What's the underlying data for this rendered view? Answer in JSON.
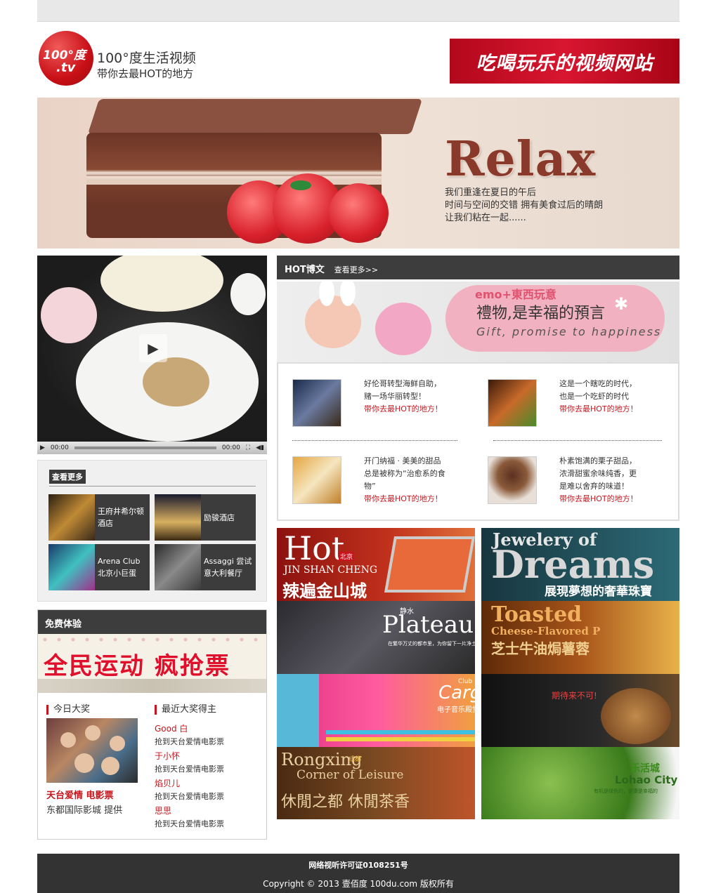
{
  "header": {
    "logo_top": "100°度",
    "logo_bottom": ".tv",
    "site_name": "100°度生活视频",
    "tagline": "带你去最HOT的地方",
    "slogan": "吃喝玩乐的视频网站"
  },
  "banner": {
    "headline": "Relax",
    "lines": [
      "我们重逢在夏日的午后",
      "时间与空间的交错  拥有美食过后的晴朗",
      "让我们粘在一起......"
    ]
  },
  "video": {
    "time_current": "00:00",
    "time_total": "00:00"
  },
  "more": {
    "title": "查看更多",
    "items": [
      {
        "name": "王府井希尔顿酒店"
      },
      {
        "name": "励骏酒店"
      },
      {
        "name": "Arena Club 北京小巨蛋"
      },
      {
        "name": "Assaggi 尝试意大利餐厅"
      }
    ]
  },
  "free": {
    "title": "免费体验",
    "banner_text": "全民运动  疯抢票",
    "today_label": "今日大奖",
    "recent_label": "最近大奖得主",
    "prize_title": "天台爱情 电影票",
    "prize_sub": "东都国际影城 提供",
    "winners": [
      {
        "name": "Good 白",
        "desc": "抢到天台爱情电影票"
      },
      {
        "name": "于小怀",
        "desc": "抢到天台爱情电影票"
      },
      {
        "name": "焰贝儿",
        "desc": "抢到天台爱情电影票"
      },
      {
        "name": "思思",
        "desc": "抢到天台爱情电影票"
      }
    ]
  },
  "hot": {
    "title": "HOT博文",
    "more_link": "查看更多>>",
    "gift_brand": "emo+東西玩意",
    "gift_cn": "禮物,是幸福的預言",
    "gift_en": "Gift, promise to happiness",
    "posts": [
      {
        "text": "好伦哥转型海鲜自助，赌一场华丽转型！",
        "tag": "带你去最HOT的地方！"
      },
      {
        "text": "这是一个瞎吃的时代，也是一个吃虾的时代",
        "tag": "带你去最HOT的地方！"
      },
      {
        "text": "开门纳福 · 美美的甜品总是被称为“治愈系的食物”",
        "tag": "带你去最HOT的地方！"
      },
      {
        "text": "朴素饱满的栗子甜品，浓滑甜蜜余味纯香，更是难以舍弃的味道！",
        "tag": "带你去最HOT的地方！"
      }
    ]
  },
  "tiles": [
    {
      "title": "Hot",
      "sub": "JIN SHAN CHENG",
      "cn": "辣遍金山城",
      "badge": "北京",
      "color": "#9b1410"
    },
    {
      "title": "Jewelery of",
      "sub": "Dreams",
      "cn": "展現夢想的奢華珠寶",
      "color": "#1f4c58"
    },
    {
      "title": "Plateau",
      "sub": "",
      "cn": "在繁华万丈的都市里，为你留下一片净土",
      "badge": "静水",
      "color": "#3b3a3f"
    },
    {
      "title": "Toasted",
      "sub": "Cheese-Flavored P",
      "cn": "芝士牛油焗薯蓉",
      "color": "#7a3b10"
    },
    {
      "title": "Cargo",
      "sub": "Club",
      "cn": "电子音乐殿堂",
      "color": "#d22a7a"
    },
    {
      "title": "",
      "sub": "",
      "cn": "期待来不可!",
      "color": "#1f1f1f"
    },
    {
      "title": "Rongxing",
      "sub": "Corner of Leisure",
      "cn": "休閒之都 休閒茶香",
      "badge": "成都",
      "color": "#6a3b1a"
    },
    {
      "title": "乐活城",
      "sub": "Lohao City",
      "cn": "有机是绿色的，健康是幸福的",
      "color": "#5f9a2c"
    }
  ],
  "footer": {
    "license": "网络视听许可证0108251号",
    "copyright": "Copyright © 2013 壹佰度 100du.com 版权所有"
  }
}
